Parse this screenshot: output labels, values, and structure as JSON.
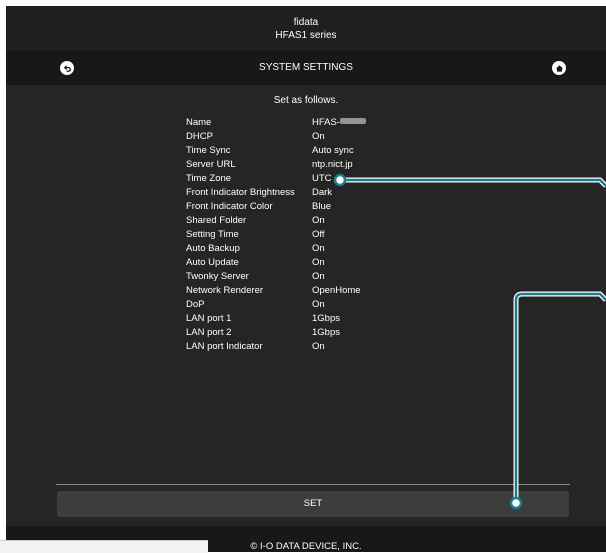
{
  "header": {
    "brand": "fidata",
    "series": "HFAS1 series"
  },
  "titlebar": {
    "title": "SYSTEM SETTINGS",
    "back_icon": "back-arrow-icon",
    "home_icon": "home-icon"
  },
  "main": {
    "subtitle": "Set as follows.",
    "settings": [
      {
        "key": "Name",
        "value": "HFAS-"
      },
      {
        "key": "DHCP",
        "value": "On"
      },
      {
        "key": "Time Sync",
        "value": "Auto sync"
      },
      {
        "key": "Server URL",
        "value": "ntp.nict.jp"
      },
      {
        "key": "Time Zone",
        "value": "UTC"
      },
      {
        "key": "Front Indicator Brightness",
        "value": "Dark"
      },
      {
        "key": "Front Indicator Color",
        "value": "Blue"
      },
      {
        "key": "Shared Folder",
        "value": "On"
      },
      {
        "key": "Setting Time",
        "value": "Off"
      },
      {
        "key": "Auto Backup",
        "value": "On"
      },
      {
        "key": "Auto Update",
        "value": "On"
      },
      {
        "key": "Twonky Server",
        "value": "On"
      },
      {
        "key": "Network Renderer",
        "value": "OpenHome"
      },
      {
        "key": "DoP",
        "value": "On"
      },
      {
        "key": "LAN port 1",
        "value": "1Gbps"
      },
      {
        "key": "LAN port 2",
        "value": "1Gbps"
      },
      {
        "key": "LAN port Indicator",
        "value": "On"
      }
    ],
    "set_button": "SET"
  },
  "footer": {
    "copyright": "© I-O DATA DEVICE, INC."
  },
  "colors": {
    "background": "#252525",
    "bar": "#181818",
    "button": "#3d3d3d",
    "callout": "#1a7f8e"
  }
}
